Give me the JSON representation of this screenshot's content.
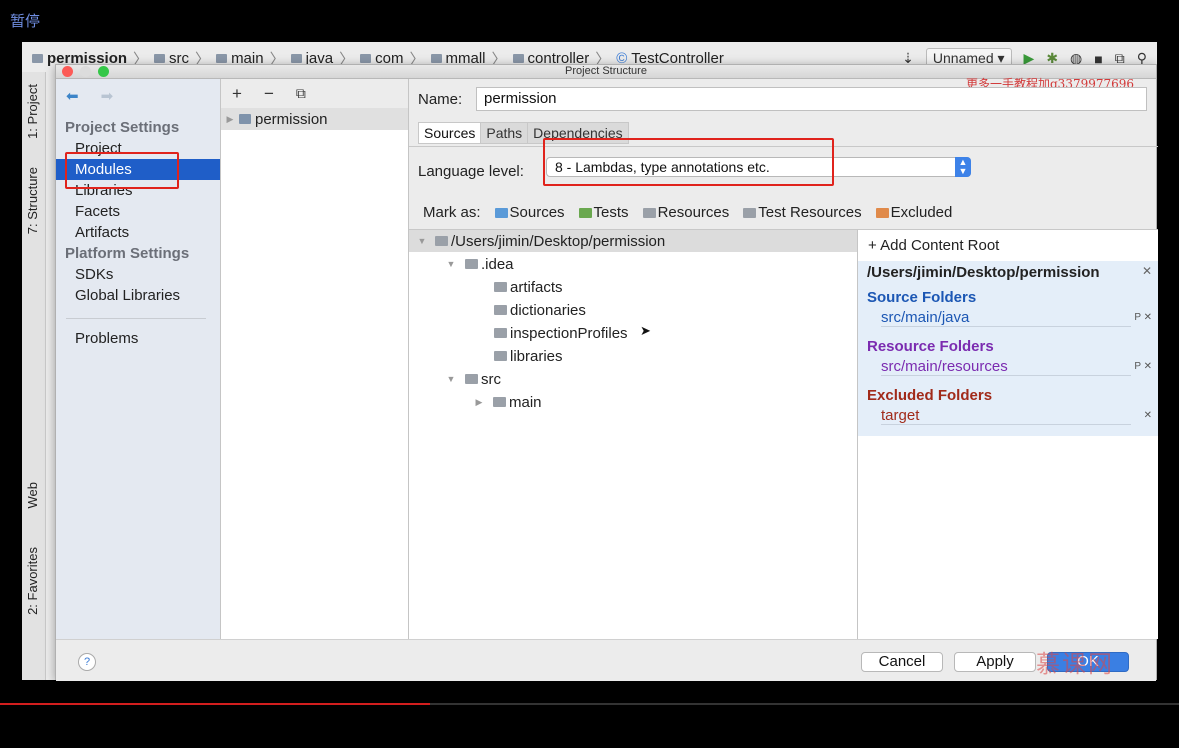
{
  "player": {
    "paused_label": "暂停"
  },
  "ide": {
    "breadcrumb": [
      "permission",
      "src",
      "main",
      "java",
      "com",
      "mmall",
      "controller",
      "TestController"
    ],
    "run_config": "Unnamed ▾",
    "side_tabs": [
      "1: Project",
      "7: Structure",
      "Web",
      "2: Favorites"
    ]
  },
  "dialog": {
    "title": "Project Structure",
    "watermark_top": "更多一手教程加q3379977696",
    "watermark_bottom": "慕课网"
  },
  "nav": {
    "project_settings_header": "Project Settings",
    "project_items": [
      "Project",
      "Modules",
      "Libraries",
      "Facets",
      "Artifacts"
    ],
    "platform_settings_header": "Platform Settings",
    "platform_items": [
      "SDKs",
      "Global Libraries"
    ],
    "problems": "Problems",
    "selected": "Modules"
  },
  "modules": {
    "toolbar": {
      "add": "+",
      "remove": "−"
    },
    "items": [
      "permission"
    ]
  },
  "detail": {
    "name_label": "Name:",
    "name_value": "permission",
    "tabs": [
      "Sources",
      "Paths",
      "Dependencies"
    ],
    "active_tab": "Sources",
    "language_label": "Language level:",
    "language_value": "8 - Lambdas, type annotations etc.",
    "mark_as_label": "Mark as:",
    "mark_as": [
      {
        "label": "Sources",
        "color": "#5a9ad8"
      },
      {
        "label": "Tests",
        "color": "#6aa84f"
      },
      {
        "label": "Resources",
        "color": "#9aa0a8"
      },
      {
        "label": "Test Resources",
        "color": "#9aa0a8"
      },
      {
        "label": "Excluded",
        "color": "#e08a4a"
      }
    ]
  },
  "tree": {
    "root": "/Users/jimin/Desktop/permission",
    "idea": ".idea",
    "idea_children": [
      "artifacts",
      "dictionaries",
      "inspectionProfiles",
      "libraries"
    ],
    "src": "src",
    "main": "main"
  },
  "content_root": {
    "add_label": "+ Add Content Root",
    "path": "/Users/jimin/Desktop/permission",
    "source_title": "Source Folders",
    "source_entry": "src/main/java",
    "resource_title": "Resource Folders",
    "resource_entry": "src/main/resources",
    "excluded_title": "Excluded Folders",
    "excluded_entry": "target",
    "colors": {
      "source": "#1c57b4",
      "resource": "#7b2bb0",
      "excluded": "#a12a1a"
    }
  },
  "footer": {
    "help": "?",
    "cancel": "Cancel",
    "apply": "Apply",
    "ok": "OK"
  }
}
